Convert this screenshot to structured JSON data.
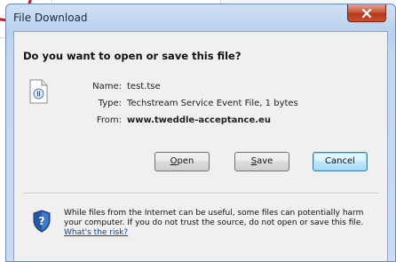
{
  "window": {
    "title": "File Download"
  },
  "dialog": {
    "question": "Do you want to open or save this file?",
    "file_info": {
      "name_label": "Name:",
      "name_value": "test.tse",
      "type_label": "Type:",
      "type_value": "Techstream Service Event File, 1 bytes",
      "from_label": "From:",
      "from_value": "www.tweddle-acceptance.eu"
    },
    "buttons": {
      "open_accel": "O",
      "open_rest": "pen",
      "save_accel": "S",
      "save_rest": "ave",
      "cancel": "Cancel"
    },
    "warning": {
      "text": "While files from the Internet can be useful, some files can potentially harm your computer. If you do not trust the source, do not open or save this file.",
      "link": "What's the risk?"
    }
  },
  "icons": {
    "close": "close-icon",
    "file": "file-type-icon",
    "shield": "security-shield-icon"
  },
  "colors": {
    "close_button": "#c75a3e",
    "default_button_border": "#3c7fb1",
    "link": "#0645ad",
    "shield_blue": "#2456a6"
  }
}
